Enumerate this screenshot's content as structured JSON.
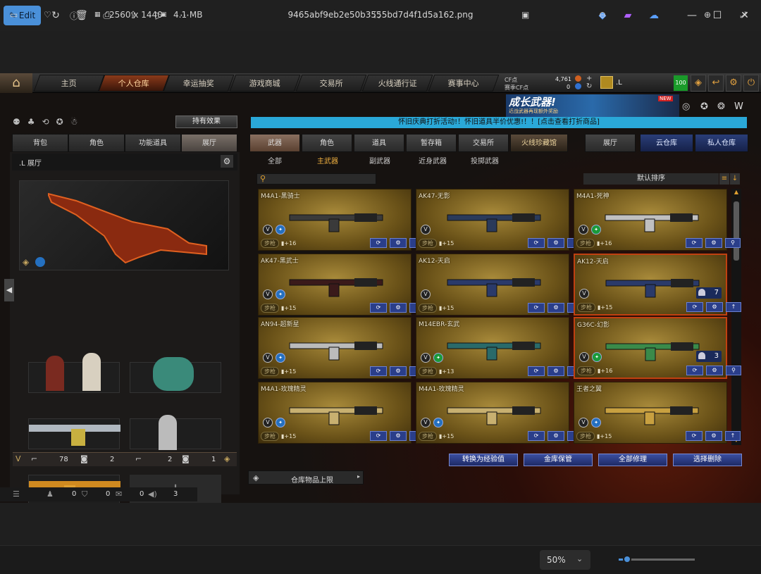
{
  "viewer": {
    "edit_label": "Edit",
    "filename": "9465abf9eb2e50b3555bd7d4f1d5a162.png",
    "dimensions": "2560 x 1440",
    "filesize": "4.1 MB",
    "zoom": "50%"
  },
  "topnav": {
    "tabs": [
      "主页",
      "个人仓库",
      "幸运抽奖",
      "游戏商城",
      "交易所",
      "火线通行证",
      "赛事中心"
    ],
    "cf_label": "CF点",
    "cf_value": "4,761",
    "season_label": "赛季CF点",
    "season_value": "0",
    "user": ".L",
    "level": "100"
  },
  "banner": {
    "title": "成长武器!",
    "subtitle": "近战武器再现额外奖励",
    "badge": "NEW"
  },
  "notice": "怀旧庆典打折活动!！怀旧道具半价优惠!！！[点击查看打折商品]",
  "left": {
    "effect_btn": "持有效果",
    "tabs": [
      "背包",
      "角色",
      "功能道具",
      "展厅"
    ],
    "hall_title": ".L 展厅",
    "stats": [
      "78",
      "2",
      "2",
      "1"
    ]
  },
  "right": {
    "tabs": [
      "武器",
      "角色",
      "道具",
      "暂存箱",
      "交易所",
      "火线珍藏馆",
      "展厅",
      "云仓库",
      "私人仓库"
    ],
    "subtabs": [
      "全部",
      "主武器",
      "副武器",
      "近身武器",
      "投掷武器"
    ],
    "sort": "默认排序"
  },
  "cards": [
    {
      "name": "M4A1-黑骑士",
      "type": "步枪",
      "plus": "+16",
      "badge": "b",
      "btn3": "up",
      "count": ""
    },
    {
      "name": "AK47-无影",
      "type": "步枪",
      "plus": "+15",
      "badge": "",
      "btn3": "up",
      "count": ""
    },
    {
      "name": "M4A1-死神",
      "type": "步枪",
      "plus": "+16",
      "badge": "g",
      "btn3": "search",
      "count": ""
    },
    {
      "name": "AK47-黑武士",
      "type": "步枪",
      "plus": "+15",
      "badge": "b",
      "btn3": "up",
      "count": ""
    },
    {
      "name": "AK12-天启",
      "type": "步枪",
      "plus": "+15",
      "badge": "",
      "btn3": "up",
      "count": ""
    },
    {
      "name": "AK12-天启",
      "type": "步枪",
      "plus": "+15",
      "badge": "",
      "btn3": "up",
      "count": "7"
    },
    {
      "name": "AN94-超新星",
      "type": "步枪",
      "plus": "+15",
      "badge": "b",
      "btn3": "up",
      "count": ""
    },
    {
      "name": "M14EBR-玄武",
      "type": "步枪",
      "plus": "+13",
      "badge": "g",
      "btn3": "search",
      "count": ""
    },
    {
      "name": "G36C-幻影",
      "type": "步枪",
      "plus": "+16",
      "badge": "g",
      "btn3": "search",
      "count": "3"
    },
    {
      "name": "M4A1-玫瑰精灵",
      "type": "步枪",
      "plus": "+15",
      "badge": "b",
      "btn3": "up",
      "count": ""
    },
    {
      "name": "M4A1-玫瑰精灵",
      "type": "步枪",
      "plus": "+15",
      "badge": "b",
      "btn3": "up",
      "count": ""
    },
    {
      "name": "王者之翼",
      "type": "步枪",
      "plus": "+15",
      "badge": "b",
      "btn3": "up",
      "count": ""
    }
  ],
  "actions": [
    "转换为经验值",
    "金库保管",
    "全部修理",
    "选择删除"
  ],
  "storage_limit": "仓库物品上限",
  "statusbar": [
    "0",
    "0",
    "0",
    "3"
  ]
}
